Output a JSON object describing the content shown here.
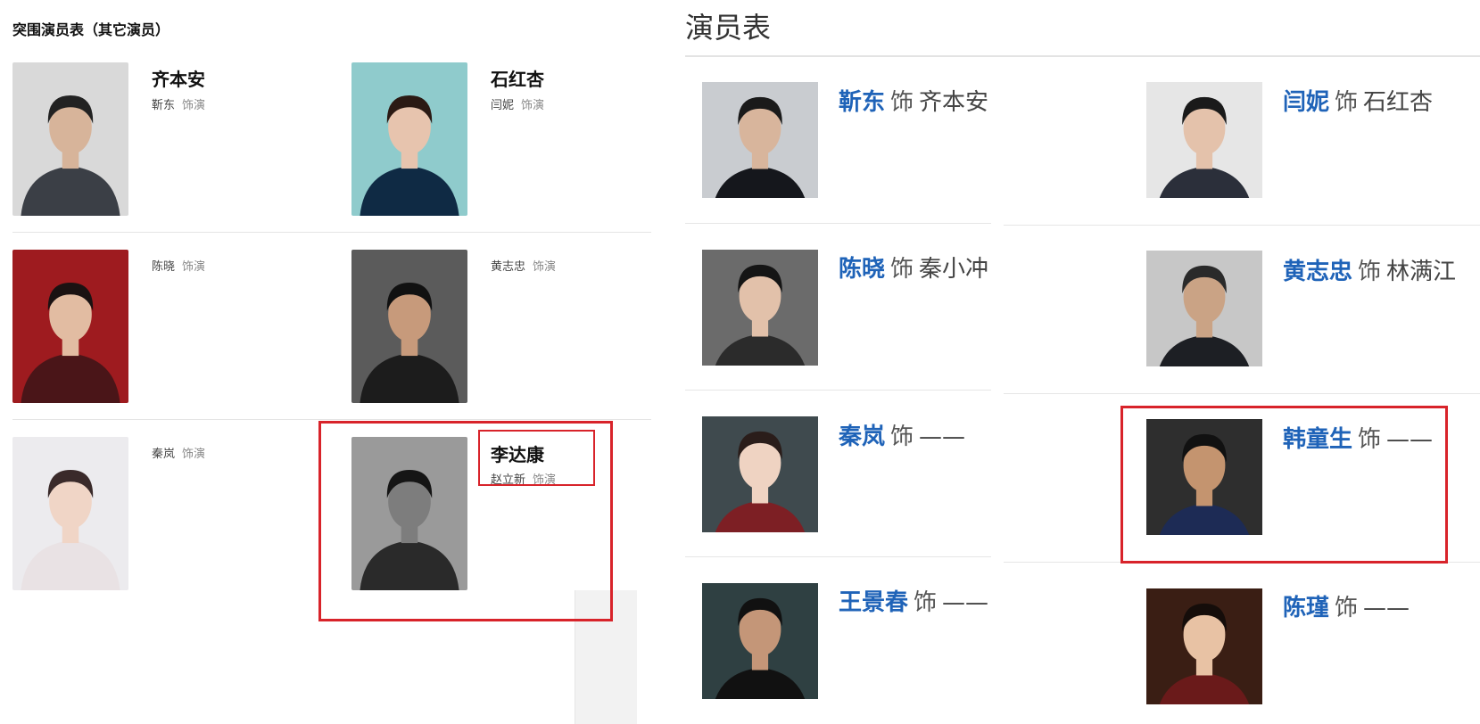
{
  "left": {
    "title": "突围演员表（其它演员）",
    "actors": [
      {
        "name": "齐本安",
        "actor": "靳东",
        "role_label": "饰演",
        "bg": "#d9d9d9",
        "skin": "#d7b49a",
        "outfit": "#3b3f46",
        "hair": "#222222"
      },
      {
        "name": "石红杏",
        "actor": "闫妮",
        "role_label": "饰演",
        "bg": "#8fcbcc",
        "skin": "#e7c4ae",
        "outfit": "#0f2a44",
        "hair": "#2b1a14"
      },
      {
        "name": "",
        "actor": "陈晓",
        "role_label": "饰演",
        "bg": "#9e1b1f",
        "skin": "#e2bca2",
        "outfit": "#4a1518",
        "hair": "#1a1212"
      },
      {
        "name": "",
        "actor": "黄志忠",
        "role_label": "饰演",
        "bg": "#5b5b5b",
        "skin": "#c79a7b",
        "outfit": "#1c1c1c",
        "hair": "#111111"
      },
      {
        "name": "",
        "actor": "秦岚",
        "role_label": "饰演",
        "bg": "#ecebee",
        "skin": "#f0d5c6",
        "outfit": "#e9e2e4",
        "hair": "#3a2a2a"
      },
      {
        "name": "李达康",
        "actor": "赵立新",
        "role_label": "饰演",
        "bg": "#9a9a9a",
        "skin": "#7d7d7d",
        "outfit": "#2a2a2a",
        "hair": "#151515"
      }
    ]
  },
  "right": {
    "title": "演员表",
    "sep_label": "饰",
    "actors": [
      {
        "actor": "靳东",
        "role": "齐本安",
        "bg": "#c9ccd0",
        "skin": "#d8b59c",
        "outfit": "#15171c",
        "hair": "#1a1a1a"
      },
      {
        "actor": "闫妮",
        "role": "石红杏",
        "bg": "#e6e6e6",
        "skin": "#e4c2ab",
        "outfit": "#2b2f3a",
        "hair": "#1a1a1a"
      },
      {
        "actor": "陈晓",
        "role": "秦小冲",
        "bg": "#6b6b6b",
        "skin": "#e2c1aa",
        "outfit": "#2b2b2b",
        "hair": "#151515"
      },
      {
        "actor": "黄志忠",
        "role": "林满江",
        "bg": "#c7c7c7",
        "skin": "#caa385",
        "outfit": "#1d1f24",
        "hair": "#2a2a2a"
      },
      {
        "actor": "秦岚",
        "role": "——",
        "bg": "#3f4a4e",
        "skin": "#efd3c2",
        "outfit": "#7d1f24",
        "hair": "#2a1d1a"
      },
      {
        "actor": "韩童生",
        "role": "——",
        "bg": "#2e2e2e",
        "skin": "#c4946f",
        "outfit": "#1d2b55",
        "hair": "#111111"
      },
      {
        "actor": "王景春",
        "role": "——",
        "bg": "#2f4042",
        "skin": "#c49678",
        "outfit": "#111111",
        "hair": "#111111"
      },
      {
        "actor": "陈瑾",
        "role": "——",
        "bg": "#3a1e14",
        "skin": "#e8c2a4",
        "outfit": "#6a1a1a",
        "hair": "#150d0a"
      }
    ]
  },
  "highlight_color": "#d8232a"
}
